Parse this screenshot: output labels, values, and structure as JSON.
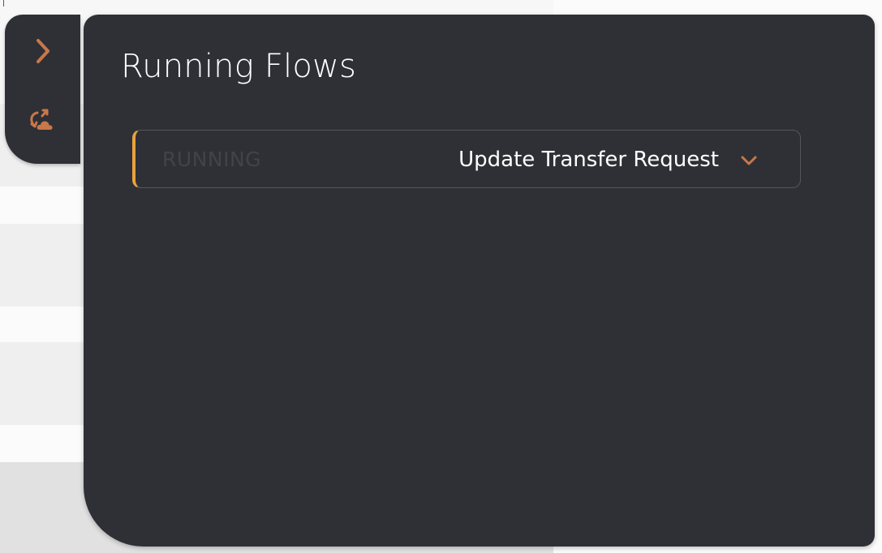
{
  "colors": {
    "panel_bg": "#2f3036",
    "accent": "#c8784a",
    "status_bar": "#e8a33d",
    "title_text": "#ffffff",
    "status_text": "#434347"
  },
  "side_rail": {
    "expand_icon": "chevron-right-icon",
    "flows_icon": "running-flows-icon"
  },
  "panel": {
    "title": "Running Flows"
  },
  "flows": [
    {
      "status": "RUNNING",
      "name": "Update Transfer Request",
      "expand_icon": "chevron-down-icon"
    }
  ]
}
